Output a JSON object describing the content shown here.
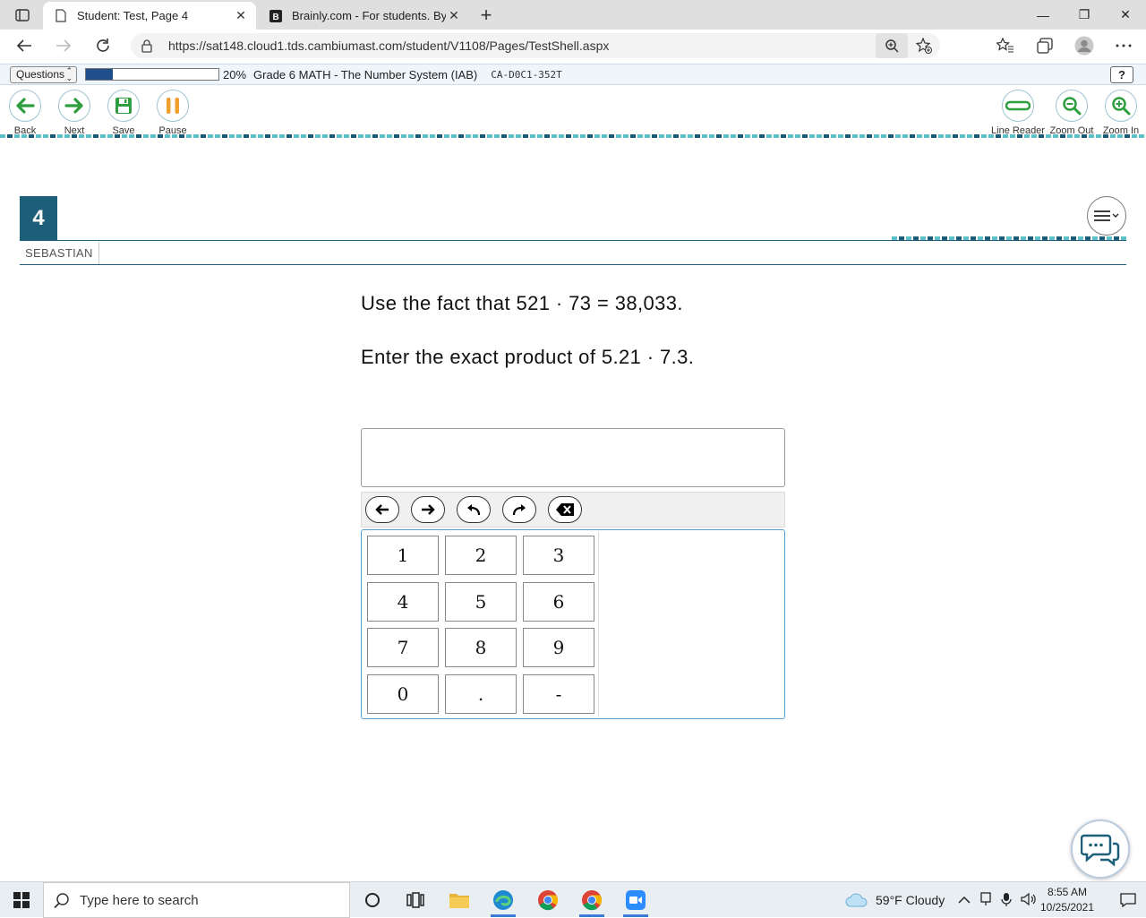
{
  "browser": {
    "tabs": [
      {
        "title": "Student: Test, Page 4",
        "active": true
      },
      {
        "title": "Brainly.com - For students. By stu",
        "active": false
      }
    ],
    "url": "https://sat148.cloud1.tds.cambiumast.com/student/V1108/Pages/TestShell.aspx"
  },
  "testbar": {
    "questions_label": "Questions",
    "progress_fraction": 0.2,
    "progress_text": "20%",
    "test_name": "Grade 6 MATH - The Number System (IAB)",
    "test_code": "CA-D0C1-352T",
    "help_label": "?"
  },
  "toolbar": {
    "back": "Back",
    "next": "Next",
    "save": "Save",
    "pause": "Pause",
    "line_reader": "Line Reader",
    "zoom_out": "Zoom Out",
    "zoom_in": "Zoom In"
  },
  "question": {
    "number": "4",
    "student": "SEBASTIAN",
    "prompt_line1": "Use the fact that 521 · 73 = 38,033.",
    "prompt_line2": "Enter the exact product of 5.21 · 7.3.",
    "answer_value": ""
  },
  "keypad": {
    "keys": [
      "1",
      "2",
      "3",
      "4",
      "5",
      "6",
      "7",
      "8",
      "9",
      "0",
      ".",
      "-"
    ]
  },
  "taskbar": {
    "search_placeholder": "Type here to search",
    "weather": "59°F  Cloudy",
    "time": "8:55 AM",
    "date": "10/25/2021"
  },
  "colors": {
    "accent": "#1d5f78",
    "teal": "#5bc0c8",
    "progress": "#1f4e8a",
    "green": "#2e9e3e",
    "orange": "#f0a030"
  }
}
